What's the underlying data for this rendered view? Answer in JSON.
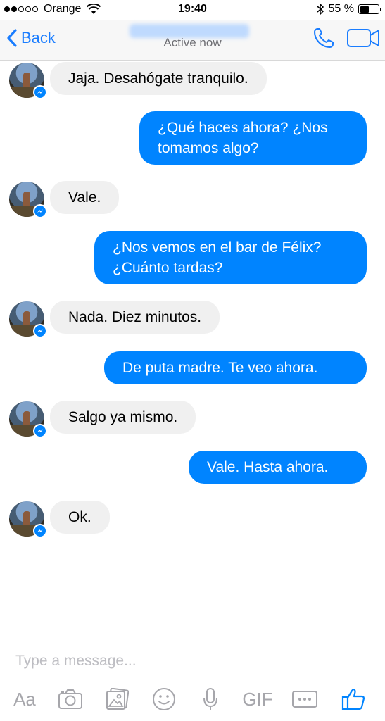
{
  "status_bar": {
    "carrier": "Orange",
    "time": "19:40",
    "battery": "55 %",
    "battery_level": 0.55
  },
  "header": {
    "back_label": "Back",
    "status": "Active now"
  },
  "messages": [
    {
      "side": "in",
      "text": "Jaja. Desahógate tranquilo."
    },
    {
      "side": "out",
      "lines": [
        "¿Qué haces ahora? ¿Nos",
        "tomamos algo?"
      ]
    },
    {
      "side": "in",
      "text": "Vale."
    },
    {
      "side": "out",
      "lines": [
        "¿Nos vemos en el bar de Félix?",
        "¿Cuánto tardas?"
      ]
    },
    {
      "side": "in",
      "text": "Nada. Diez minutos."
    },
    {
      "side": "out",
      "text": "De puta madre. Te veo ahora."
    },
    {
      "side": "in",
      "text": "Salgo ya mismo."
    },
    {
      "side": "out",
      "text": "Vale. Hasta ahora."
    },
    {
      "side": "in",
      "text": "Ok."
    }
  ],
  "composer": {
    "placeholder": "Type a message...",
    "text_tool": "Aa",
    "gif_tool": "GIF"
  },
  "colors": {
    "accent": "#0084ff",
    "incoming_bubble": "#f0f0f0",
    "nav_blue": "#1a7dff"
  },
  "icons": [
    "wifi-icon",
    "bluetooth-icon",
    "battery-icon",
    "back-chevron-icon",
    "phone-icon",
    "video-camera-icon",
    "messenger-badge-icon",
    "camera-icon",
    "photo-gallery-icon",
    "emoji-icon",
    "microphone-icon",
    "more-icon",
    "thumbs-up-icon"
  ]
}
